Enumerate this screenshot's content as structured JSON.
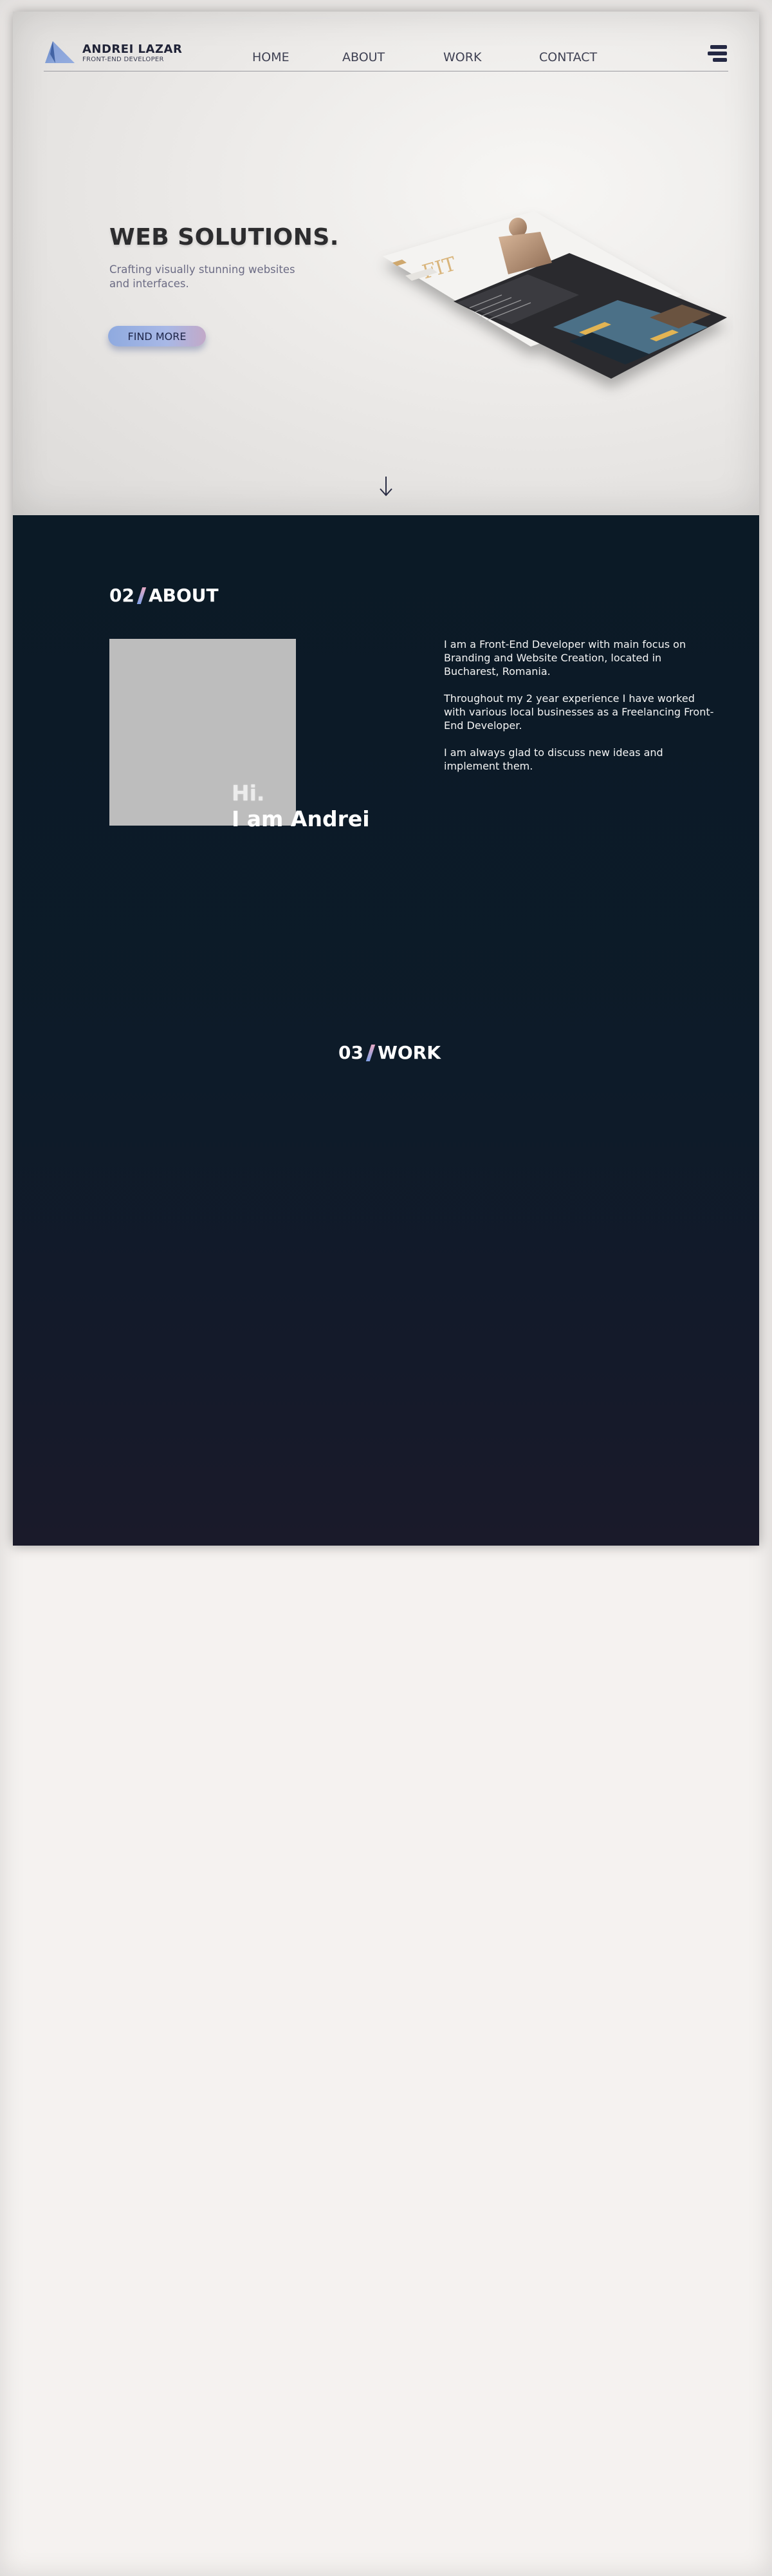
{
  "brand": {
    "name": "ANDREI LAZAR",
    "role": "FRONT-END DEVELOPER",
    "logo_icon": "triangle-logo-icon"
  },
  "nav": {
    "items": [
      {
        "label": "HOME"
      },
      {
        "label": "ABOUT"
      },
      {
        "label": "WORK"
      },
      {
        "label": "CONTACT"
      }
    ],
    "menu_icon": "hamburger-menu-icon"
  },
  "hero": {
    "title": "WEB SOLUTIONS.",
    "subtitle": "Crafting visually stunning websites and interfaces.",
    "button_label": "FIND MORE",
    "scroll_icon": "arrow-down-icon",
    "mockup_label": "FIT"
  },
  "about": {
    "number": "02",
    "heading": "ABOUT",
    "greeting_line1": "Hi.",
    "greeting_line2": "I am Andrei",
    "paragraphs": [
      "I am a Front-End Developer with main focus on Branding and Website Creation, located in Bucharest, Romania.",
      "Throughout my 2 year experience I have worked with various local businesses as a Freelancing Front-End Developer.",
      "I am always glad to discuss new ideas and implement them."
    ]
  },
  "work": {
    "number": "03",
    "heading": "WORK"
  },
  "colors": {
    "dark_bg": "#0b1a26",
    "accent_blue": "#8faadf",
    "accent_pink": "#e7a9c4",
    "brand_navy": "#242843"
  }
}
